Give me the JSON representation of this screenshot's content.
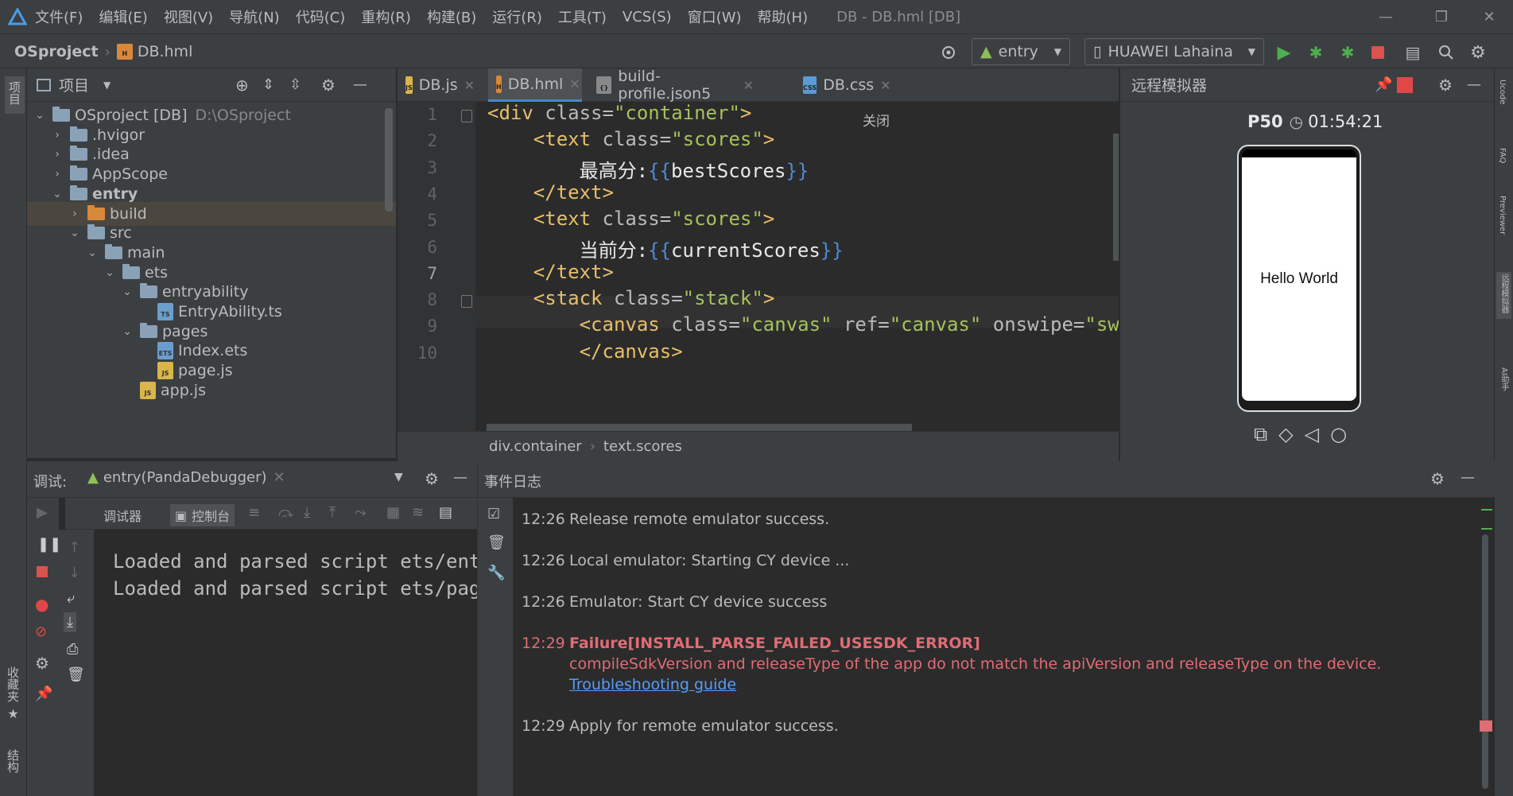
{
  "menubar": {
    "items": [
      "文件(F)",
      "编辑(E)",
      "视图(V)",
      "导航(N)",
      "代码(C)",
      "重构(R)",
      "构建(B)",
      "运行(R)",
      "工具(T)",
      "VCS(S)",
      "窗口(W)",
      "帮助(H)"
    ],
    "window_title": "DB - DB.hml [DB]"
  },
  "navbar": {
    "project": "OSproject",
    "file": "DB.hml",
    "module_combo": "entry",
    "device_combo": "HUAWEI Lahaina"
  },
  "left_strip": {
    "project_label": "项目",
    "favorites_label": "收藏夹",
    "structure_label": "结构"
  },
  "project": {
    "header": "项目",
    "tree": [
      {
        "label": "OSproject [DB]",
        "extra": "D:\\OSproject",
        "depth": 0,
        "expanded": true,
        "type": "module"
      },
      {
        "label": ".hvigor",
        "depth": 1,
        "expanded": false,
        "type": "folder"
      },
      {
        "label": ".idea",
        "depth": 1,
        "expanded": false,
        "type": "folder"
      },
      {
        "label": "AppScope",
        "depth": 1,
        "expanded": false,
        "type": "folder"
      },
      {
        "label": "entry",
        "depth": 1,
        "expanded": true,
        "type": "module"
      },
      {
        "label": "build",
        "depth": 2,
        "expanded": false,
        "type": "folder-orange"
      },
      {
        "label": "src",
        "depth": 2,
        "expanded": true,
        "type": "folder"
      },
      {
        "label": "main",
        "depth": 3,
        "expanded": true,
        "type": "folder"
      },
      {
        "label": "ets",
        "depth": 4,
        "expanded": true,
        "type": "folder"
      },
      {
        "label": "entryability",
        "depth": 5,
        "expanded": true,
        "type": "folder"
      },
      {
        "label": "EntryAbility.ts",
        "depth": 6,
        "type": "ts"
      },
      {
        "label": "pages",
        "depth": 5,
        "expanded": true,
        "type": "folder"
      },
      {
        "label": "Index.ets",
        "depth": 6,
        "type": "ets"
      },
      {
        "label": "page.js",
        "depth": 6,
        "type": "js"
      },
      {
        "label": "app.js",
        "depth": 5,
        "type": "js"
      }
    ]
  },
  "editor": {
    "tabs": [
      {
        "label": "DB.js",
        "icon": "JS"
      },
      {
        "label": "DB.hml",
        "icon": "H",
        "active": true
      },
      {
        "label": "build-profile.json5",
        "icon": "{}"
      },
      {
        "label": "DB.css",
        "icon": "CSS"
      }
    ],
    "close_hint": "关闭",
    "line_numbers": [
      "1",
      "2",
      "3",
      "4",
      "5",
      "6",
      "7",
      "8",
      "9",
      "10"
    ],
    "lines": [
      {
        "indent": "",
        "parts": [
          [
            "tag",
            "<div "
          ],
          [
            "attr",
            "class="
          ],
          [
            "str",
            "\"container\""
          ],
          [
            "tag",
            ">"
          ]
        ]
      },
      {
        "indent": "    ",
        "parts": [
          [
            "tag",
            "<text "
          ],
          [
            "attr",
            "class="
          ],
          [
            "str",
            "\"scores\""
          ],
          [
            "tag",
            ">"
          ]
        ]
      },
      {
        "indent": "        ",
        "parts": [
          [
            "var",
            "最高分:"
          ],
          [
            "brace",
            "{{"
          ],
          [
            "var",
            "bestScores"
          ],
          [
            "brace",
            "}}"
          ]
        ]
      },
      {
        "indent": "    ",
        "parts": [
          [
            "tag",
            "</text>"
          ]
        ]
      },
      {
        "indent": "    ",
        "parts": [
          [
            "tag",
            "<text "
          ],
          [
            "attr",
            "class="
          ],
          [
            "str",
            "\"scores\""
          ],
          [
            "tag",
            ">"
          ]
        ]
      },
      {
        "indent": "        ",
        "parts": [
          [
            "var",
            "当前分:"
          ],
          [
            "brace",
            "{{"
          ],
          [
            "var",
            "currentScores"
          ],
          [
            "brace",
            "}}"
          ]
        ]
      },
      {
        "indent": "    ",
        "parts": [
          [
            "tag",
            "</text>"
          ]
        ]
      },
      {
        "indent": "    ",
        "parts": [
          [
            "tag",
            "<stack "
          ],
          [
            "attr",
            "class="
          ],
          [
            "str",
            "\"stack\""
          ],
          [
            "tag",
            ">"
          ]
        ]
      },
      {
        "indent": "        ",
        "parts": [
          [
            "tag",
            "<canvas "
          ],
          [
            "attr",
            "class="
          ],
          [
            "str",
            "\"canvas\" "
          ],
          [
            "attr",
            "ref="
          ],
          [
            "str",
            "\"canvas\" "
          ],
          [
            "attr",
            "onswipe="
          ],
          [
            "str",
            "\"swipe"
          ]
        ]
      },
      {
        "indent": "        ",
        "parts": [
          [
            "tag",
            "</canvas>"
          ]
        ]
      }
    ],
    "breadcrumb": [
      "div.container",
      "text.scores"
    ]
  },
  "emulator": {
    "title": "远程模拟器",
    "device": "P50",
    "timer": "01:54:21",
    "screen_text": "Hello World"
  },
  "debug": {
    "label": "调试:",
    "session": "entry(PandaDebugger)",
    "tab_debugger": "调试器",
    "tab_console": "控制台",
    "console_lines": [
      "Loaded and parsed script ets/entr",
      "Loaded and parsed script ets/page"
    ]
  },
  "events": {
    "title": "事件日志",
    "entries": [
      {
        "time": "12:26",
        "text": "Release remote emulator success."
      },
      {
        "time": "12:26",
        "text": "Local emulator: Starting CY device ..."
      },
      {
        "time": "12:26",
        "text": "Emulator: Start CY device success"
      },
      {
        "time": "12:29",
        "text": "Failure[INSTALL_PARSE_FAILED_USESDK_ERROR]",
        "detail": "compileSdkVersion and releaseType of the app do not match the apiVersion and releaseType on the device.",
        "link": "Troubleshooting guide",
        "error": true
      },
      {
        "time": "12:29",
        "text": "Apply for remote emulator success."
      }
    ]
  },
  "right_strip": [
    "Ucode",
    "FAQ",
    "Previewer",
    "远程模拟器",
    "AI助手"
  ],
  "colors": {
    "accent": "#4a88c7",
    "error": "#e06c75",
    "link": "#589df6",
    "string": "#a5c25c",
    "tag": "#e8bf6a"
  }
}
